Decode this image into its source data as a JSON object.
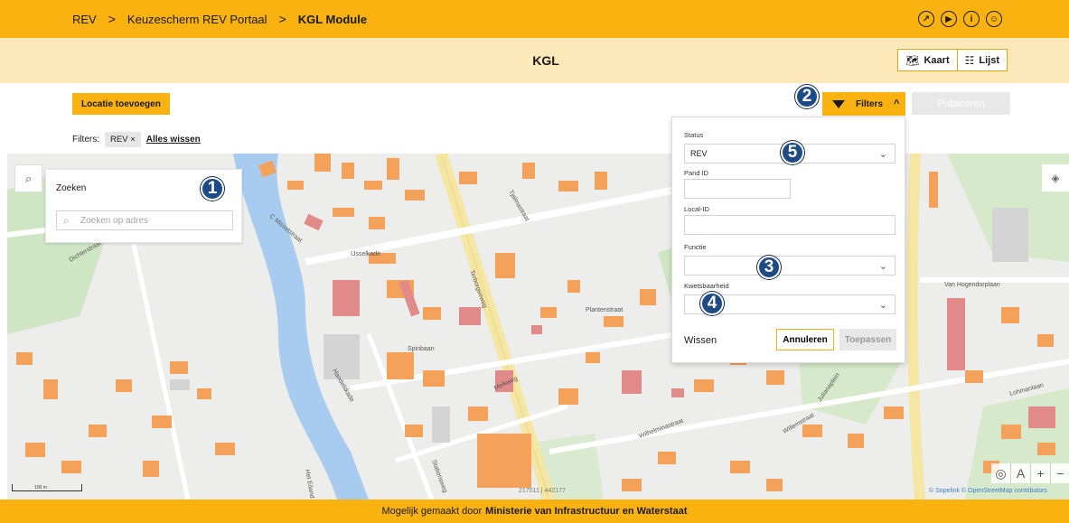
{
  "breadcrumb": {
    "items": [
      "REV",
      "Keuzescherm REV Portaal",
      "KGL Module"
    ],
    "separator": ">"
  },
  "top_icons": [
    "share-icon",
    "cursor-icon",
    "info-icon",
    "user-icon"
  ],
  "title": "KGL",
  "view_toggle": {
    "map_label": "Kaart",
    "list_label": "Lijst"
  },
  "actions": {
    "add_location": "Locatie toevoegen",
    "filters": "Filters",
    "publish": "Publiceren"
  },
  "active_filters": {
    "label": "Filters:",
    "chips": [
      "REV ×"
    ],
    "clear_all": "Alles wissen"
  },
  "search": {
    "title": "Zoeken",
    "placeholder": "Zoeken op adres"
  },
  "filter_panel": {
    "status_label": "Status",
    "status_value": "REV",
    "pand_id_label": "Pand ID",
    "local_id_label": "Local-ID",
    "functie_label": "Functie",
    "kwetsbaarheid_label": "Kwetsbaarheid",
    "clear": "Wissen",
    "cancel": "Annuleren",
    "apply": "Toepassen"
  },
  "badges": [
    "1",
    "2",
    "3",
    "4",
    "5"
  ],
  "map": {
    "coords": "217011 | 442177",
    "scale": "100 m",
    "attribution": "© Sopelink © OpenStreetMap contributors",
    "labels": [
      "C Missetstraat",
      "IJsselkade",
      "Spinbaan",
      "Handelskade",
      "Plantenstraat",
      "Tjalmastraat",
      "Melkweg",
      "Wilhelminastraat",
      "Julianaplein",
      "Willemstraat",
      "Van Hogendorplaan",
      "Lohmanlaan",
      "Terborgseweg",
      "Dichterstraat",
      "Het Eiland",
      "Stationsweg"
    ]
  },
  "colors": {
    "accent": "#f9b20f",
    "accent_light": "#fde8b9",
    "badge": "#1e4a86",
    "building": "#f4a25b",
    "building_special": "#e08a8a"
  },
  "footer": {
    "prefix": "Mogelijk gemaakt door",
    "org": "Ministerie van Infrastructuur en Waterstaat"
  }
}
